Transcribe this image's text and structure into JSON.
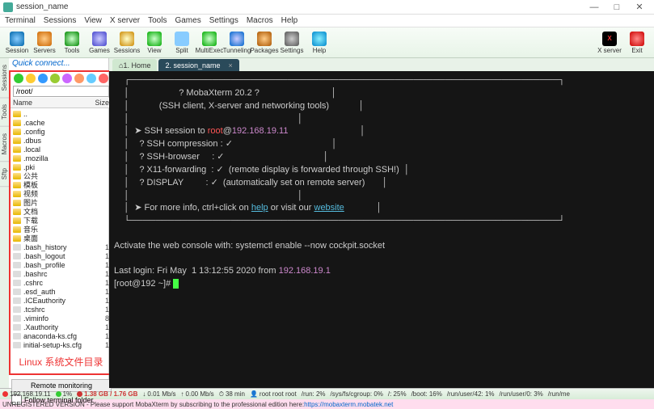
{
  "window": {
    "title": "session_name"
  },
  "menu": [
    "Terminal",
    "Sessions",
    "View",
    "X server",
    "Tools",
    "Games",
    "Settings",
    "Macros",
    "Help"
  ],
  "toolbar": [
    {
      "k": "session",
      "l": "Session"
    },
    {
      "k": "servers",
      "l": "Servers"
    },
    {
      "k": "tools",
      "l": "Tools"
    },
    {
      "k": "games",
      "l": "Games"
    },
    {
      "k": "sessions",
      "l": "Sessions"
    },
    {
      "k": "view",
      "l": "View"
    },
    {
      "k": "split",
      "l": "Split"
    },
    {
      "k": "multi",
      "l": "MultiExec"
    },
    {
      "k": "tunnel",
      "l": "Tunneling"
    },
    {
      "k": "pkg",
      "l": "Packages"
    },
    {
      "k": "settings",
      "l": "Settings"
    },
    {
      "k": "help",
      "l": "Help"
    }
  ],
  "toolbar_right": [
    {
      "k": "xserver",
      "l": "X server"
    },
    {
      "k": "exit",
      "l": "Exit"
    }
  ],
  "sidetabs": [
    "Sessions",
    "Tools",
    "Macros",
    "Sftp"
  ],
  "quickconnect": "Quick connect...",
  "path": "/root/",
  "fcols": {
    "name": "Name",
    "size": "Size"
  },
  "files": [
    {
      "n": "..",
      "d": true,
      "s": ""
    },
    {
      "n": ".cache",
      "d": true,
      "s": ""
    },
    {
      "n": ".config",
      "d": true,
      "s": ""
    },
    {
      "n": ".dbus",
      "d": true,
      "s": ""
    },
    {
      "n": ".local",
      "d": true,
      "s": ""
    },
    {
      "n": ".mozilla",
      "d": true,
      "s": ""
    },
    {
      "n": ".pki",
      "d": true,
      "s": ""
    },
    {
      "n": "公共",
      "d": true,
      "s": ""
    },
    {
      "n": "模板",
      "d": true,
      "s": ""
    },
    {
      "n": "视频",
      "d": true,
      "s": ""
    },
    {
      "n": "图片",
      "d": true,
      "s": ""
    },
    {
      "n": "文档",
      "d": true,
      "s": ""
    },
    {
      "n": "下载",
      "d": true,
      "s": ""
    },
    {
      "n": "音乐",
      "d": true,
      "s": ""
    },
    {
      "n": "桌面",
      "d": true,
      "s": ""
    },
    {
      "n": ".bash_history",
      "d": false,
      "s": "1"
    },
    {
      "n": ".bash_logout",
      "d": false,
      "s": "1"
    },
    {
      "n": ".bash_profile",
      "d": false,
      "s": "1"
    },
    {
      "n": ".bashrc",
      "d": false,
      "s": "1"
    },
    {
      "n": ".cshrc",
      "d": false,
      "s": "1"
    },
    {
      "n": ".esd_auth",
      "d": false,
      "s": "1"
    },
    {
      "n": ".ICEauthority",
      "d": false,
      "s": "1"
    },
    {
      "n": ".tcshrc",
      "d": false,
      "s": "1"
    },
    {
      "n": ".viminfo",
      "d": false,
      "s": "8"
    },
    {
      "n": ".Xauthority",
      "d": false,
      "s": "1"
    },
    {
      "n": "anaconda-ks.cfg",
      "d": false,
      "s": "1"
    },
    {
      "n": "initial-setup-ks.cfg",
      "d": false,
      "s": "1"
    }
  ],
  "annotation": "Linux 系统文件目录",
  "remote_monitoring": "Remote monitoring",
  "follow_terminal": "Follow terminal folder",
  "tabs": {
    "home": "1. Home",
    "active": "2. session_name"
  },
  "term": {
    "banner_title": "? MobaXterm 20.2 ?",
    "banner_sub": "(SSH client, X-server and networking tools)",
    "l1a": "  ➤ SSH session to ",
    "user": "root",
    "at": "@",
    "host": "192.168.19.11",
    "l2": "    ? SSH compression : ✓",
    "l3": "    ? SSH-browser     : ✓",
    "l4": "    ? X11-forwarding  : ✓  (remote display is forwarded through SSH!)",
    "l5": "    ? DISPLAY         : ✓  (automatically set on remote server)",
    "l6a": "  ➤ For more info, ctrl+click on ",
    "help": "help",
    "l6b": " or visit our ",
    "website": "website",
    "activate": "Activate the web console with: systemctl enable --now cockpit.socket",
    "lastlogin_a": "Last login: Fri May  1 13:12:55 2020 from ",
    "lastlogin_b": "192.168.19.1",
    "prompt": "[root@192 ~]# "
  },
  "status": {
    "ip": "192.168.19.11",
    "cpu": "1%",
    "mem": "1.38 GB / 1.76 GB",
    "down": "0.01 Mb/s",
    "up": "0.00 Mb/s",
    "time": "38 min",
    "user": "root root root",
    "a": "/run: 2%",
    "b": "/sys/fs/cgroup: 0%",
    "c": "/: 25%",
    "d": "/boot: 16%",
    "e": "/run/user/42: 1%",
    "f": "/run/user/0: 3%",
    "g": "/run/me"
  },
  "footer": {
    "pre": "UNREGISTERED VERSION - Please support MobaXterm by subscribing to the professional edition here: ",
    "url": "https://mobaxterm.mobatek.net"
  }
}
